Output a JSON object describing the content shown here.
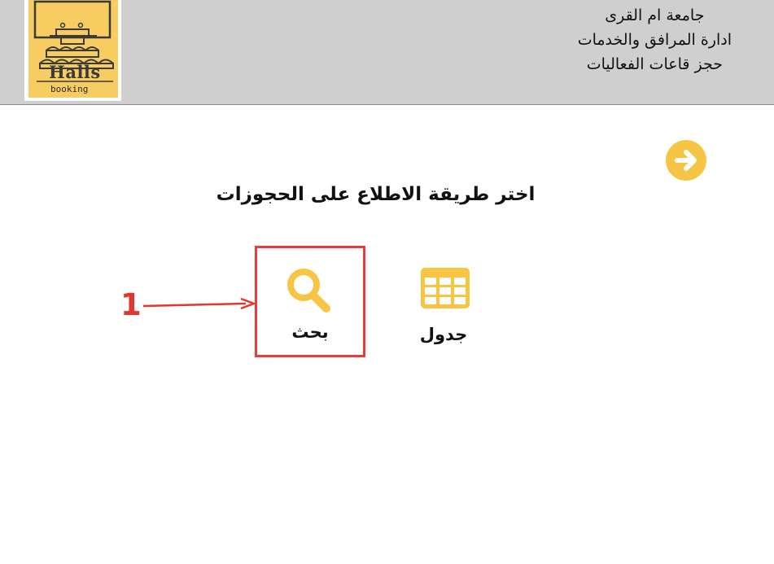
{
  "header": {
    "logo": {
      "title": "Halls",
      "subtitle": "booking",
      "colors": {
        "background": "#f7cd62",
        "ink": "#3a3a3a"
      }
    },
    "lines": [
      "جامعة ام القرى",
      "ادارة المرافق والخدمات",
      "حجز قاعات الفعاليات"
    ]
  },
  "navigation": {
    "next_icon": "arrow-right-circle-icon"
  },
  "main": {
    "prompt": "اختر طريقة الاطلاع على الحجوزات",
    "options": [
      {
        "label": "بحث",
        "icon": "search-icon",
        "highlighted": true
      },
      {
        "label": "جدول",
        "icon": "table-grid-icon",
        "highlighted": false
      }
    ]
  },
  "annotation": {
    "step_number": "1",
    "color": "#e0382f"
  },
  "colors": {
    "accent": "#f6c544",
    "header_background": "#cfcfcf",
    "highlight_border": "#ea3b3b"
  }
}
